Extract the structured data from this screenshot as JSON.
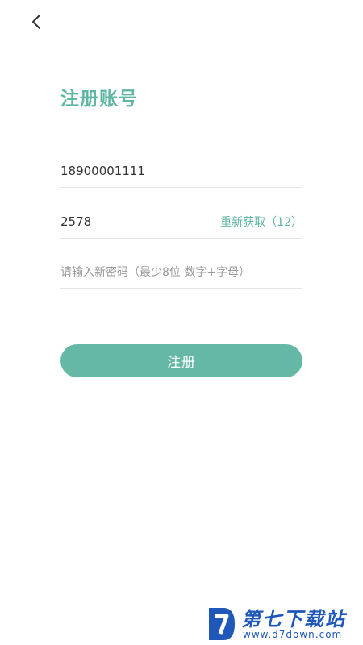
{
  "header": {
    "back_icon": "chevron-left-icon"
  },
  "page": {
    "title": "注册账号"
  },
  "form": {
    "phone": {
      "value": "18900001111",
      "placeholder": ""
    },
    "code": {
      "value": "2578",
      "placeholder": "",
      "resend_label": "重新获取（12）"
    },
    "password": {
      "value": "",
      "placeholder": "请输入新密码（最少8位 数字+字母）"
    },
    "submit_label": "注册"
  },
  "watermark": {
    "brand": "第七下载站",
    "url": "www.d7down.com"
  },
  "colors": {
    "accent": "#5fb6a3",
    "button": "#66b8a6",
    "watermark": "#1f58b8"
  }
}
